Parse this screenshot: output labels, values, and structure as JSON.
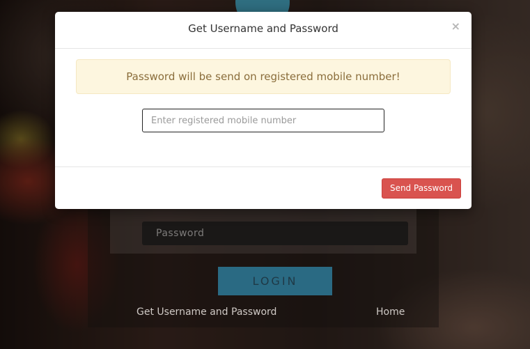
{
  "background": {
    "login": {
      "password_placeholder": "Password",
      "login_button": "LOGIN",
      "get_credentials_link": "Get Username and Password",
      "home_link": "Home"
    }
  },
  "modal": {
    "title": "Get Username and Password",
    "close_symbol": "×",
    "alert_text": "Password will be send on registered mobile number!",
    "mobile_placeholder": "Enter registered mobile number",
    "mobile_value": "",
    "send_button": "Send Password"
  },
  "colors": {
    "alert_bg": "#fdf6df",
    "alert_text": "#8a6d3b",
    "send_button_bg": "#d9534f",
    "login_button_bg": "#2a6a83"
  }
}
